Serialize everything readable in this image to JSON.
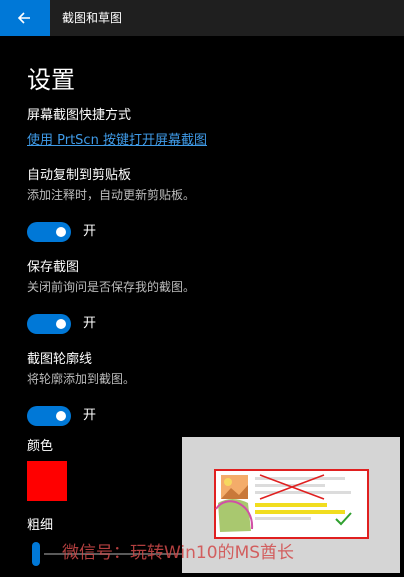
{
  "titlebar": {
    "app_title": "截图和草图",
    "back_icon": "arrow-left-icon"
  },
  "page": {
    "title": "设置"
  },
  "shortcut": {
    "title": "屏幕截图快捷方式",
    "link": "使用 PrtScn 按键打开屏幕截图"
  },
  "auto_copy": {
    "title": "自动复制到剪贴板",
    "desc": "添加注释时，自动更新剪贴板。",
    "toggle_state": "开",
    "on": true
  },
  "save_snip": {
    "title": "保存截图",
    "desc": "关闭前询问是否保存我的截图。",
    "toggle_state": "开",
    "on": true
  },
  "outline": {
    "title": "截图轮廓线",
    "desc": "将轮廓添加到截图。",
    "toggle_state": "开",
    "on": true
  },
  "color": {
    "title": "颜色",
    "value": "#ff0000"
  },
  "thickness": {
    "title": "粗细",
    "value": 0.05
  },
  "accent_color": "#0078d7",
  "watermark": {
    "text": "微信号：玩转Win10的MS酋长"
  }
}
